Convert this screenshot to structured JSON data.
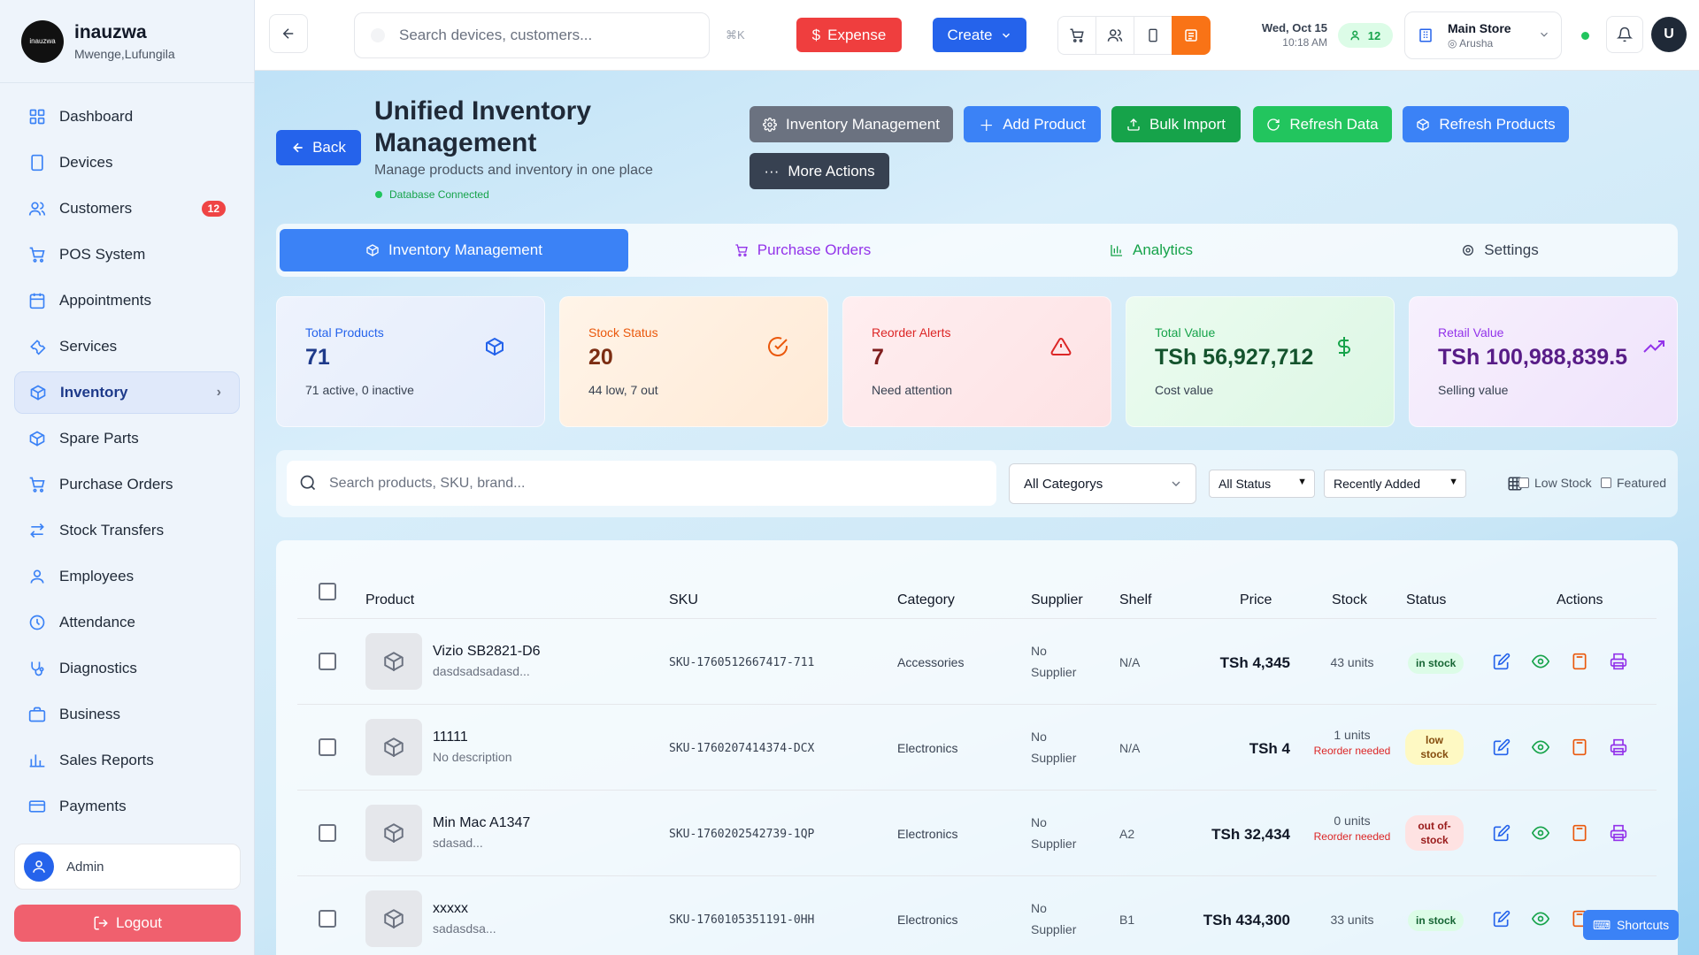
{
  "brand": {
    "name": "inauzwa",
    "location": "Mwenge,Lufungila",
    "logo_text": "inauzwa"
  },
  "sidebar": {
    "items": [
      {
        "label": "Dashboard",
        "icon": "grid-icon"
      },
      {
        "label": "Devices",
        "icon": "tablet-icon"
      },
      {
        "label": "Customers",
        "icon": "users-icon",
        "badge": "12"
      },
      {
        "label": "POS System",
        "icon": "cart-icon"
      },
      {
        "label": "Appointments",
        "icon": "calendar-icon"
      },
      {
        "label": "Services",
        "icon": "wrench-icon"
      },
      {
        "label": "Inventory",
        "icon": "box-icon",
        "active": true
      },
      {
        "label": "Spare Parts",
        "icon": "box-icon"
      },
      {
        "label": "Purchase Orders",
        "icon": "cart-icon"
      },
      {
        "label": "Stock Transfers",
        "icon": "arrows-icon"
      },
      {
        "label": "Employees",
        "icon": "user-icon"
      },
      {
        "label": "Attendance",
        "icon": "clock-icon"
      },
      {
        "label": "Diagnostics",
        "icon": "stethoscope-icon"
      },
      {
        "label": "Business",
        "icon": "briefcase-icon"
      },
      {
        "label": "Sales Reports",
        "icon": "bar-chart-icon"
      },
      {
        "label": "Payments",
        "icon": "card-icon"
      }
    ],
    "user": "Admin",
    "logout": "Logout"
  },
  "topbar": {
    "search_placeholder": "Search devices, customers...",
    "shortcut_hint": "⌘K",
    "expense_label": "Expense",
    "create_label": "Create",
    "date": "Wed, Oct 15",
    "time": "10:18 AM",
    "online_users": "12",
    "store_name": "Main Store",
    "store_location": "Arusha",
    "avatar_initial": "U"
  },
  "header": {
    "back_label": "Back",
    "title": "Unified Inventory Management",
    "subtitle": "Manage products and inventory in one place",
    "db_status": "Database Connected",
    "actions": {
      "inventory_management": "Inventory Management",
      "add_product": "Add Product",
      "bulk_import": "Bulk Import",
      "refresh_data": "Refresh Data",
      "refresh_products": "Refresh Products",
      "more_actions": "More Actions"
    }
  },
  "tabs": {
    "inventory": "Inventory Management",
    "purchase_orders": "Purchase Orders",
    "analytics": "Analytics",
    "settings": "Settings"
  },
  "stats": {
    "total_products": {
      "label": "Total Products",
      "value": "71",
      "sub": "71 active, 0 inactive"
    },
    "stock_status": {
      "label": "Stock Status",
      "value": "20",
      "sub": "44 low, 7 out"
    },
    "reorder_alerts": {
      "label": "Reorder Alerts",
      "value": "7",
      "sub": "Need attention"
    },
    "total_value": {
      "label": "Total Value",
      "value": "TSh 56,927,712",
      "sub": "Cost value"
    },
    "retail_value": {
      "label": "Retail Value",
      "value": "TSh 100,988,839.5",
      "sub": "Selling value"
    }
  },
  "filters": {
    "search_placeholder": "Search products, SKU, brand...",
    "category": "All Categorys",
    "status": "All Status",
    "sort": "Recently Added",
    "low_stock": "Low Stock",
    "featured": "Featured"
  },
  "table": {
    "columns": {
      "product": "Product",
      "sku": "SKU",
      "category": "Category",
      "supplier": "Supplier",
      "shelf": "Shelf",
      "price": "Price",
      "stock": "Stock",
      "status": "Status",
      "actions": "Actions"
    },
    "rows": [
      {
        "name": "Vizio SB2821-D6",
        "desc": "dasdsadsadasd...",
        "sku": "SKU-1760512667417-711",
        "category": "Accessories",
        "supplier": "No Supplier",
        "shelf": "N/A",
        "price": "TSh 4,345",
        "stock": "43 units",
        "reorder": "",
        "status": "in stock"
      },
      {
        "name": "11111",
        "desc": "No description",
        "sku": "SKU-1760207414374-DCX",
        "category": "Electronics",
        "supplier": "No Supplier",
        "shelf": "N/A",
        "price": "TSh 4",
        "stock": "1 units",
        "reorder": "Reorder needed",
        "status": "low stock"
      },
      {
        "name": "Min Mac A1347",
        "desc": "sdasad...",
        "sku": "SKU-1760202542739-1QP",
        "category": "Electronics",
        "supplier": "No Supplier",
        "shelf": "A2",
        "price": "TSh 32,434",
        "stock": "0 units",
        "reorder": "Reorder needed",
        "status": "out of-stock"
      },
      {
        "name": "xxxxx",
        "desc": "sadasdsa...",
        "sku": "SKU-1760105351191-0HH",
        "category": "Electronics",
        "supplier": "No Supplier",
        "shelf": "B1",
        "price": "TSh 434,300",
        "stock": "33 units",
        "reorder": "",
        "status": "in stock"
      }
    ]
  },
  "shortcuts_label": "Shortcuts",
  "colors": {
    "primary": "#2563eb",
    "expense": "#ef3e3e",
    "logout": "#f0606e",
    "success": "#16a34a"
  }
}
